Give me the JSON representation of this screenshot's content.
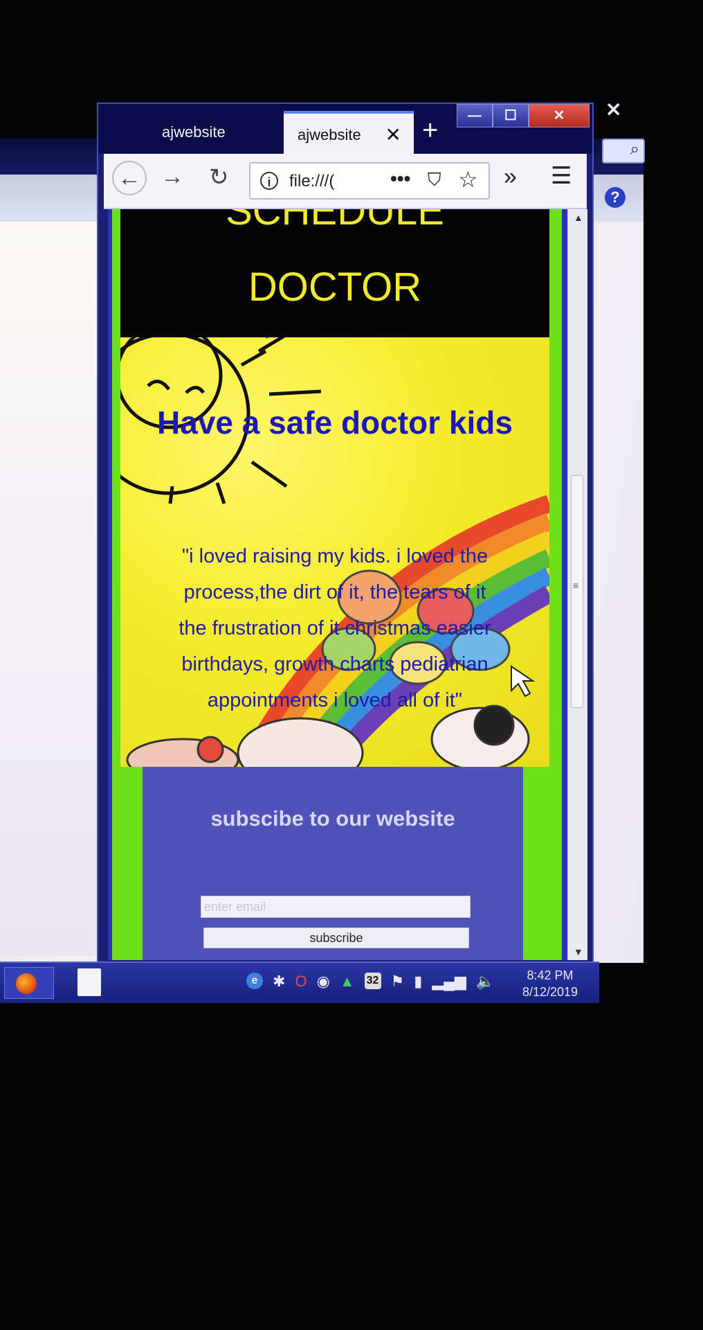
{
  "browser": {
    "tabs": [
      {
        "label": "ajwebsite",
        "active": false
      },
      {
        "label": "ajwebsite",
        "active": true
      }
    ],
    "new_tab_label": "+",
    "tab_close_label": "✕",
    "window_buttons": {
      "minimize": "—",
      "maximize": "☐",
      "close": "✕"
    },
    "nav": {
      "back": "←",
      "forward": "→",
      "reload": "↻"
    },
    "url": "file:///(",
    "url_more": "•••",
    "pocket": "⛉",
    "bookmark": "☆",
    "overflow": "»",
    "menu": "☰"
  },
  "page": {
    "header_lines": [
      "SCHEDULE",
      "DOCTOR"
    ],
    "hero_title": "Have a safe doctor kids",
    "quote": "\"i loved raising my kids. i loved the process,the dirt of it, the tears of it the frustration of it christmas easier birthdays, growth charts pediatrian appointments i loved all of it\"",
    "subscribe_title": "subscibe to our website",
    "email_placeholder": "enter email",
    "subscribe_button": "subscribe"
  },
  "taskbar": {
    "time": "8:42 PM",
    "date": "8/12/2019",
    "tray_number": "32"
  },
  "background_window": {
    "close_label": "✕",
    "help_label": "?"
  },
  "colors": {
    "header_bg": "#050505",
    "header_text": "#f1ea2c",
    "hero_bg": "#f4ec2a",
    "hero_title": "#1b17b8",
    "frame_green": "#6ee01a",
    "subscribe_bg": "#5052b9"
  }
}
